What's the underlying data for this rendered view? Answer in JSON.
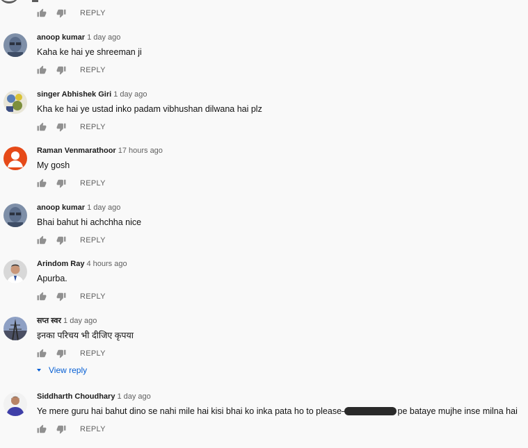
{
  "reply_label": "REPLY",
  "top_actions": {
    "reply": "REPLY"
  },
  "comments": [
    {
      "author": "anoop kumar",
      "time": "1 day ago",
      "text": "Kaha ke hai ye shreeman ji",
      "avatar": "avatar-anoop"
    },
    {
      "author": "singer Abhishek Giri",
      "time": "1 day ago",
      "text": "Kha ke hai ye ustad  inko padam vibhushan dilwana hai plz",
      "avatar": "avatar-abhishek"
    },
    {
      "author": "Raman Venmarathoor",
      "time": "17 hours ago",
      "text": "My gosh",
      "avatar": "avatar-default"
    },
    {
      "author": "anoop kumar",
      "time": "1 day ago",
      "text": "Bhai bahut hi achchha nice",
      "avatar": "avatar-anoop"
    },
    {
      "author": "Arindom Ray",
      "time": "4 hours ago",
      "text": "Apurba.",
      "avatar": "avatar-arindom"
    },
    {
      "author": "सप्त स्वर",
      "time": "1 day ago",
      "text": "इनका परिचय भी दीजिए कृपया",
      "avatar": "avatar-tower"
    },
    {
      "author": "Siddharth Choudhary",
      "time": "1 day ago",
      "text_before": "Ye mere guru hai bahut dino se nahi mile hai kisi bhai ko inka pata ho to please",
      "text_after": "pe bataye mujhe inse milna hai",
      "avatar": "avatar-siddharth"
    }
  ],
  "view_reply": "View reply",
  "colors": {
    "link": "#065fd4",
    "meta": "#606060",
    "background": "#f9f9f9"
  }
}
